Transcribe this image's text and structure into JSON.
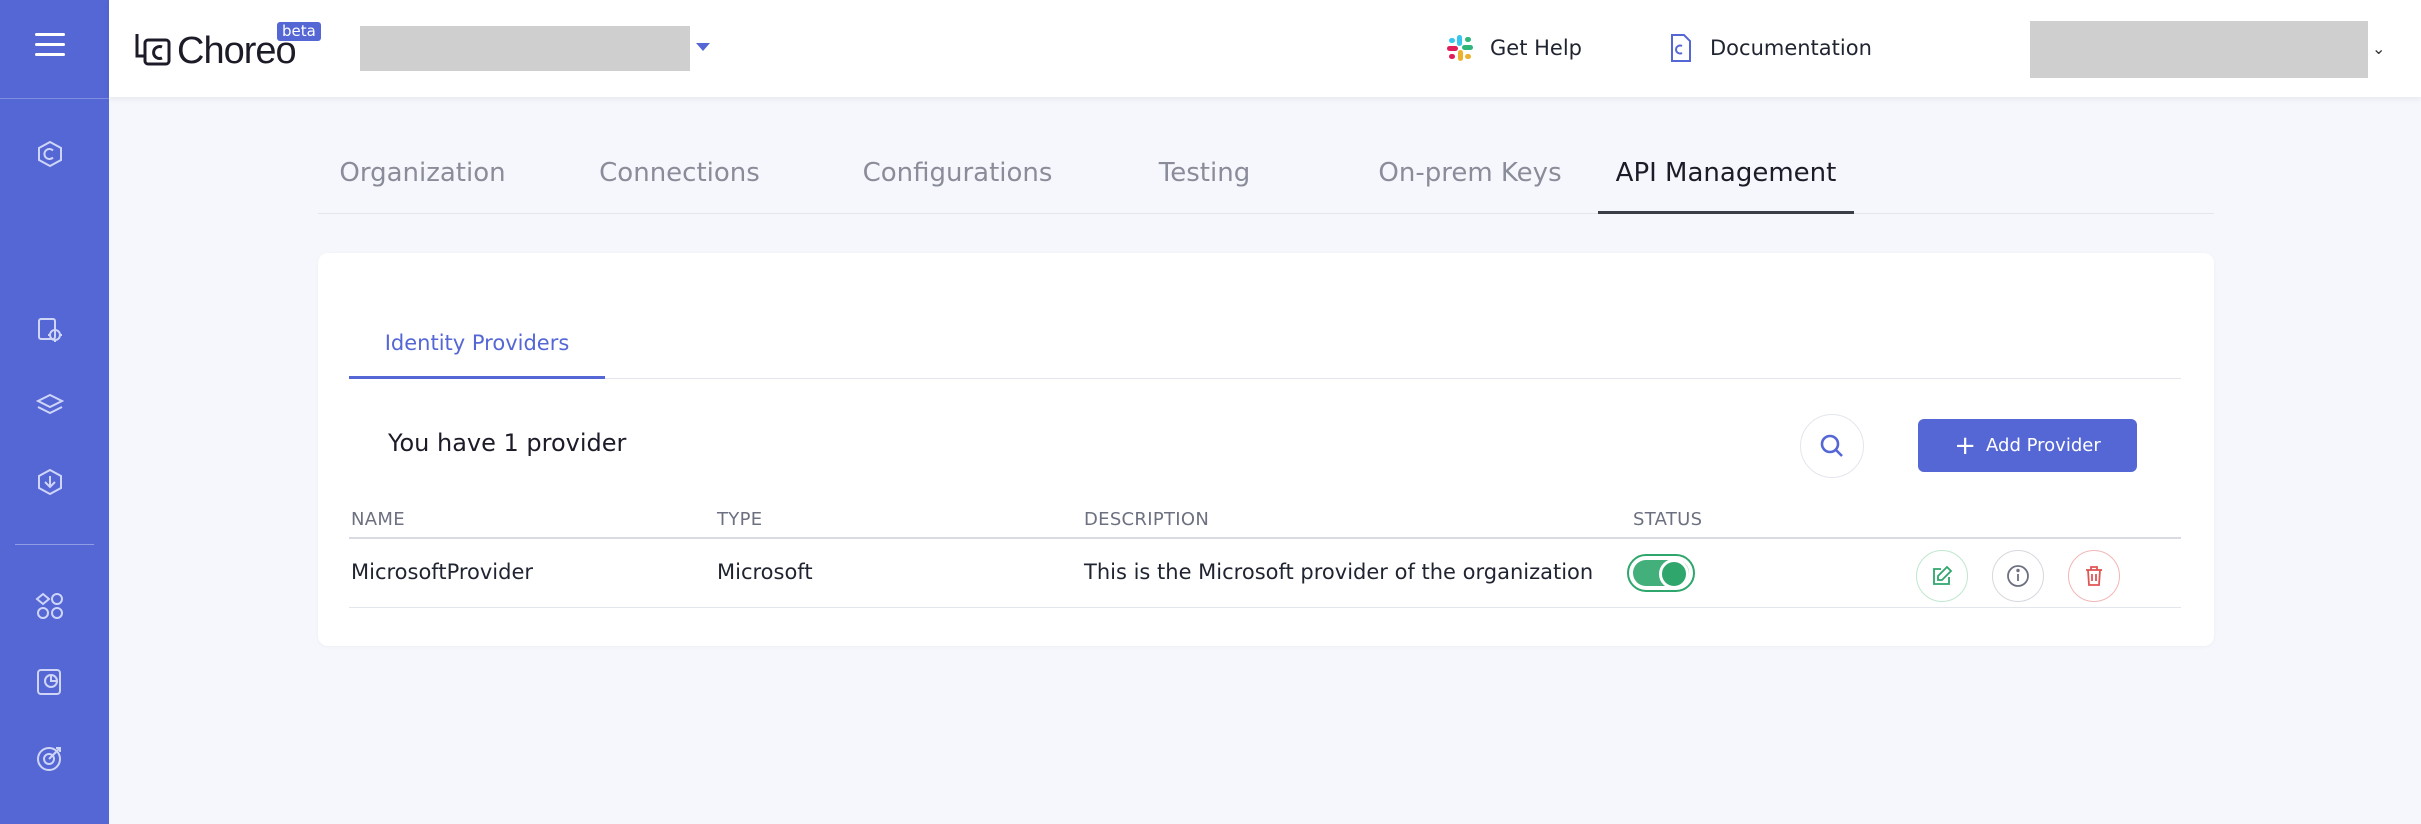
{
  "header": {
    "logo_text": "Choreo",
    "beta_badge": "beta",
    "get_help_label": "Get Help",
    "documentation_label": "Documentation"
  },
  "tabs": [
    {
      "label": "Organization"
    },
    {
      "label": "Connections"
    },
    {
      "label": "Configurations"
    },
    {
      "label": "Testing"
    },
    {
      "label": "On-prem Keys"
    },
    {
      "label": "API Management"
    }
  ],
  "active_tab": "API Management",
  "card": {
    "subtab_label": "Identity Providers",
    "count_text": "You have 1 provider",
    "add_button_label": "Add Provider",
    "columns": [
      "NAME",
      "TYPE",
      "DESCRIPTION",
      "STATUS"
    ],
    "rows": [
      {
        "name": "MicrosoftProvider",
        "type": "Microsoft",
        "description": "This is the Microsoft provider of the organization",
        "status_enabled": true
      }
    ]
  },
  "colors": {
    "accent": "#5567d5",
    "status_on": "#2fa66b",
    "delete": "#e05555"
  },
  "icons": {
    "rail": [
      "hamburger-icon",
      "home-icon",
      "settings-icon",
      "layers-icon",
      "download-icon",
      "apps-icon",
      "analytics-icon",
      "target-icon"
    ],
    "header": [
      "slack-icon",
      "documentation-icon"
    ],
    "row_actions": [
      "edit-icon",
      "info-icon",
      "delete-icon"
    ]
  }
}
